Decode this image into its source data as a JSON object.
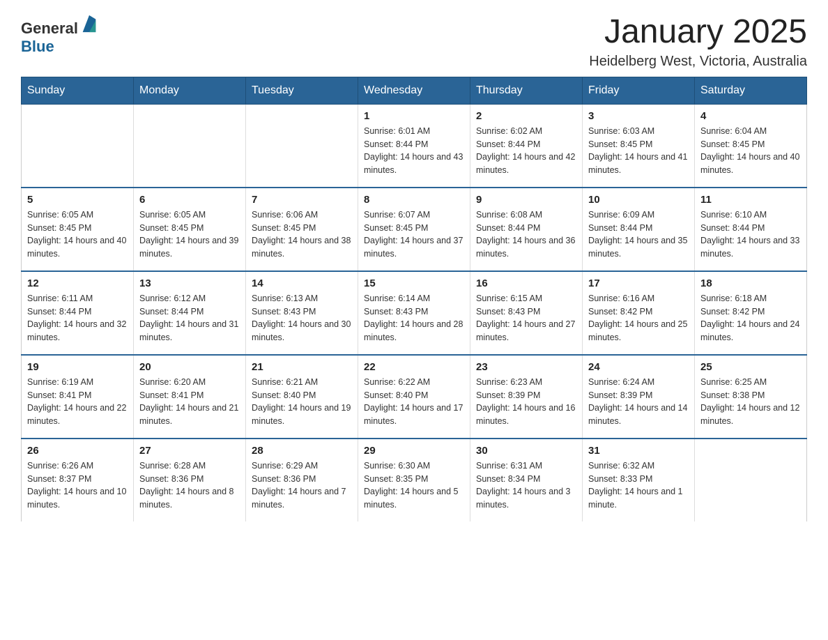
{
  "header": {
    "logo_general": "General",
    "logo_blue": "Blue",
    "month_title": "January 2025",
    "location": "Heidelberg West, Victoria, Australia"
  },
  "days_of_week": [
    "Sunday",
    "Monday",
    "Tuesday",
    "Wednesday",
    "Thursday",
    "Friday",
    "Saturday"
  ],
  "weeks": [
    [
      {
        "num": "",
        "info": ""
      },
      {
        "num": "",
        "info": ""
      },
      {
        "num": "",
        "info": ""
      },
      {
        "num": "1",
        "info": "Sunrise: 6:01 AM\nSunset: 8:44 PM\nDaylight: 14 hours and 43 minutes."
      },
      {
        "num": "2",
        "info": "Sunrise: 6:02 AM\nSunset: 8:44 PM\nDaylight: 14 hours and 42 minutes."
      },
      {
        "num": "3",
        "info": "Sunrise: 6:03 AM\nSunset: 8:45 PM\nDaylight: 14 hours and 41 minutes."
      },
      {
        "num": "4",
        "info": "Sunrise: 6:04 AM\nSunset: 8:45 PM\nDaylight: 14 hours and 40 minutes."
      }
    ],
    [
      {
        "num": "5",
        "info": "Sunrise: 6:05 AM\nSunset: 8:45 PM\nDaylight: 14 hours and 40 minutes."
      },
      {
        "num": "6",
        "info": "Sunrise: 6:05 AM\nSunset: 8:45 PM\nDaylight: 14 hours and 39 minutes."
      },
      {
        "num": "7",
        "info": "Sunrise: 6:06 AM\nSunset: 8:45 PM\nDaylight: 14 hours and 38 minutes."
      },
      {
        "num": "8",
        "info": "Sunrise: 6:07 AM\nSunset: 8:45 PM\nDaylight: 14 hours and 37 minutes."
      },
      {
        "num": "9",
        "info": "Sunrise: 6:08 AM\nSunset: 8:44 PM\nDaylight: 14 hours and 36 minutes."
      },
      {
        "num": "10",
        "info": "Sunrise: 6:09 AM\nSunset: 8:44 PM\nDaylight: 14 hours and 35 minutes."
      },
      {
        "num": "11",
        "info": "Sunrise: 6:10 AM\nSunset: 8:44 PM\nDaylight: 14 hours and 33 minutes."
      }
    ],
    [
      {
        "num": "12",
        "info": "Sunrise: 6:11 AM\nSunset: 8:44 PM\nDaylight: 14 hours and 32 minutes."
      },
      {
        "num": "13",
        "info": "Sunrise: 6:12 AM\nSunset: 8:44 PM\nDaylight: 14 hours and 31 minutes."
      },
      {
        "num": "14",
        "info": "Sunrise: 6:13 AM\nSunset: 8:43 PM\nDaylight: 14 hours and 30 minutes."
      },
      {
        "num": "15",
        "info": "Sunrise: 6:14 AM\nSunset: 8:43 PM\nDaylight: 14 hours and 28 minutes."
      },
      {
        "num": "16",
        "info": "Sunrise: 6:15 AM\nSunset: 8:43 PM\nDaylight: 14 hours and 27 minutes."
      },
      {
        "num": "17",
        "info": "Sunrise: 6:16 AM\nSunset: 8:42 PM\nDaylight: 14 hours and 25 minutes."
      },
      {
        "num": "18",
        "info": "Sunrise: 6:18 AM\nSunset: 8:42 PM\nDaylight: 14 hours and 24 minutes."
      }
    ],
    [
      {
        "num": "19",
        "info": "Sunrise: 6:19 AM\nSunset: 8:41 PM\nDaylight: 14 hours and 22 minutes."
      },
      {
        "num": "20",
        "info": "Sunrise: 6:20 AM\nSunset: 8:41 PM\nDaylight: 14 hours and 21 minutes."
      },
      {
        "num": "21",
        "info": "Sunrise: 6:21 AM\nSunset: 8:40 PM\nDaylight: 14 hours and 19 minutes."
      },
      {
        "num": "22",
        "info": "Sunrise: 6:22 AM\nSunset: 8:40 PM\nDaylight: 14 hours and 17 minutes."
      },
      {
        "num": "23",
        "info": "Sunrise: 6:23 AM\nSunset: 8:39 PM\nDaylight: 14 hours and 16 minutes."
      },
      {
        "num": "24",
        "info": "Sunrise: 6:24 AM\nSunset: 8:39 PM\nDaylight: 14 hours and 14 minutes."
      },
      {
        "num": "25",
        "info": "Sunrise: 6:25 AM\nSunset: 8:38 PM\nDaylight: 14 hours and 12 minutes."
      }
    ],
    [
      {
        "num": "26",
        "info": "Sunrise: 6:26 AM\nSunset: 8:37 PM\nDaylight: 14 hours and 10 minutes."
      },
      {
        "num": "27",
        "info": "Sunrise: 6:28 AM\nSunset: 8:36 PM\nDaylight: 14 hours and 8 minutes."
      },
      {
        "num": "28",
        "info": "Sunrise: 6:29 AM\nSunset: 8:36 PM\nDaylight: 14 hours and 7 minutes."
      },
      {
        "num": "29",
        "info": "Sunrise: 6:30 AM\nSunset: 8:35 PM\nDaylight: 14 hours and 5 minutes."
      },
      {
        "num": "30",
        "info": "Sunrise: 6:31 AM\nSunset: 8:34 PM\nDaylight: 14 hours and 3 minutes."
      },
      {
        "num": "31",
        "info": "Sunrise: 6:32 AM\nSunset: 8:33 PM\nDaylight: 14 hours and 1 minute."
      },
      {
        "num": "",
        "info": ""
      }
    ]
  ]
}
